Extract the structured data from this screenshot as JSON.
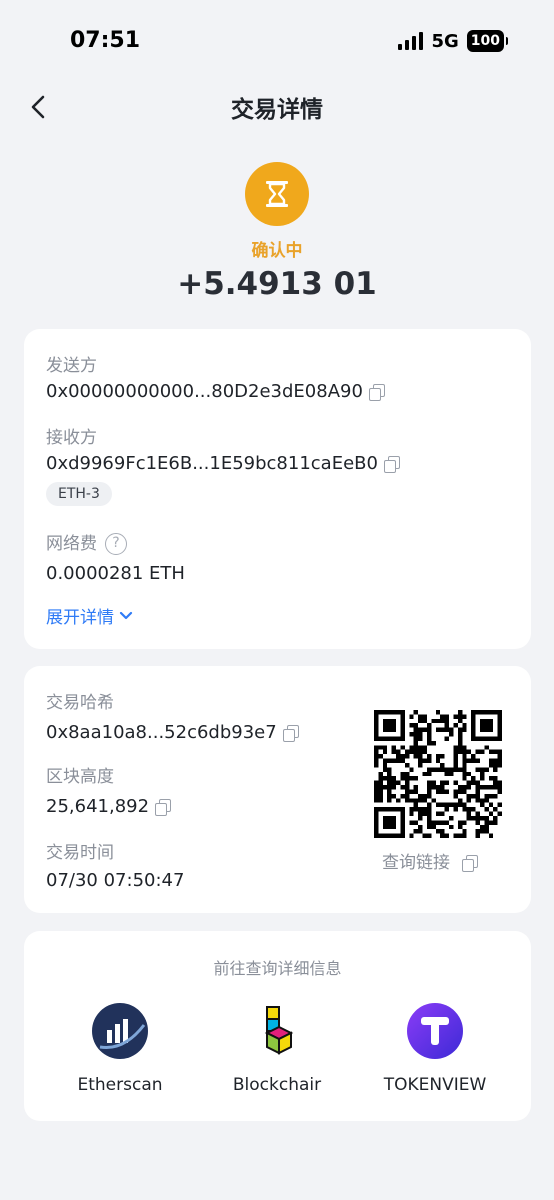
{
  "status_bar": {
    "time": "07:51",
    "network": "5G",
    "battery": "100"
  },
  "nav": {
    "title": "交易详情",
    "back_icon": "chevron-left-icon"
  },
  "header": {
    "status_icon": "hourglass-icon",
    "status_text": "确认中",
    "amount": "+5.4913 01",
    "status_color": "#f0a81c"
  },
  "parties": {
    "sender_label": "发送方",
    "sender_address": "0x00000000000...80D2e3dE08A90",
    "receiver_label": "接收方",
    "receiver_address": "0xd9969Fc1E6B...1E59bc811caEeB0",
    "receiver_tag": "ETH-3",
    "fee_label": "网络费",
    "fee_value": "0.0000281 ETH",
    "expand_label": "展开详情"
  },
  "tx": {
    "hash_label": "交易哈希",
    "hash_value": "0x8aa10a8...52c6db93e7",
    "block_label": "区块高度",
    "block_value": "25,641,892",
    "time_label": "交易时间",
    "time_value": "07/30 07:50:47",
    "qr_link_label": "查询链接"
  },
  "explorers": {
    "title": "前往查询详细信息",
    "items": [
      {
        "name": "Etherscan",
        "icon": "etherscan-logo-icon"
      },
      {
        "name": "Blockchair",
        "icon": "blockchair-logo-icon"
      },
      {
        "name": "TOKENVIEW",
        "icon": "tokenview-logo-icon"
      }
    ]
  },
  "colors": {
    "accent": "#2f7bf6",
    "pending": "#f0a81c",
    "background": "#f2f3f6"
  }
}
